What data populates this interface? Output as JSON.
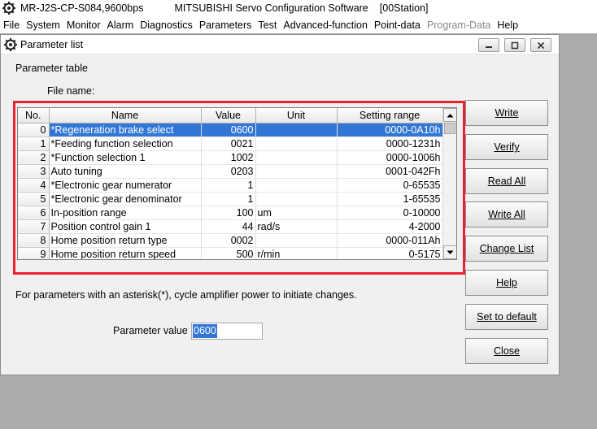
{
  "app": {
    "connection": "MR-J2S-CP-S084,9600bps",
    "title": "MITSUBISHI Servo Configuration Software",
    "station": "[00Station]"
  },
  "menu": [
    "File",
    "System",
    "Monitor",
    "Alarm",
    "Diagnostics",
    "Parameters",
    "Test",
    "Advanced-function",
    "Point-data",
    "Program-Data",
    "Help"
  ],
  "menu_disabled": "Program-Data",
  "dialog": {
    "title": "Parameter list",
    "section_label": "Parameter table",
    "file_name_label": "File name:",
    "file_name_value": "",
    "note": "For parameters with an asterisk(*), cycle amplifier power to initiate changes.",
    "param_value_label": "Parameter value",
    "param_value": "0600"
  },
  "table": {
    "headers": [
      "No.",
      "Name",
      "Value",
      "Unit",
      "Setting range"
    ],
    "rows": [
      {
        "no": "0",
        "name": "*Regeneration brake select",
        "value": "0600",
        "unit": "",
        "range": "0000-0A10h"
      },
      {
        "no": "1",
        "name": "*Feeding function selection",
        "value": "0021",
        "unit": "",
        "range": "0000-1231h"
      },
      {
        "no": "2",
        "name": "*Function selection 1",
        "value": "1002",
        "unit": "",
        "range": "0000-1006h"
      },
      {
        "no": "3",
        "name": "Auto tuning",
        "value": "0203",
        "unit": "",
        "range": "0001-042Fh"
      },
      {
        "no": "4",
        "name": "*Electronic gear numerator",
        "value": "1",
        "unit": "",
        "range": "0-65535"
      },
      {
        "no": "5",
        "name": "*Electronic gear denominator",
        "value": "1",
        "unit": "",
        "range": "1-65535"
      },
      {
        "no": "6",
        "name": "In-position range",
        "value": "100",
        "unit": "um",
        "range": "0-10000"
      },
      {
        "no": "7",
        "name": "Position control gain 1",
        "value": "44",
        "unit": "rad/s",
        "range": "4-2000"
      },
      {
        "no": "8",
        "name": "Home position return type",
        "value": "0002",
        "unit": "",
        "range": "0000-011Ah"
      },
      {
        "no": "9",
        "name": "Home position return speed",
        "value": "500",
        "unit": "r/min",
        "range": "0-5175"
      }
    ],
    "selected_row": 0
  },
  "buttons": {
    "write": "Write",
    "verify": "Verify",
    "read_all": "Read All",
    "write_all": "Write All",
    "change_list": "Change List",
    "help": "Help",
    "set_default": "Set to default",
    "close": "Close"
  },
  "icons": {
    "app": "servo-gear-icon",
    "dialog": "servo-gear-icon",
    "minimize": "minimize-icon",
    "maximize": "maximize-icon",
    "close": "close-icon",
    "scroll_up": "arrow-up-icon",
    "scroll_down": "arrow-down-icon"
  },
  "colors": {
    "selection": "#3377d6",
    "highlight_frame": "#e8222f"
  }
}
